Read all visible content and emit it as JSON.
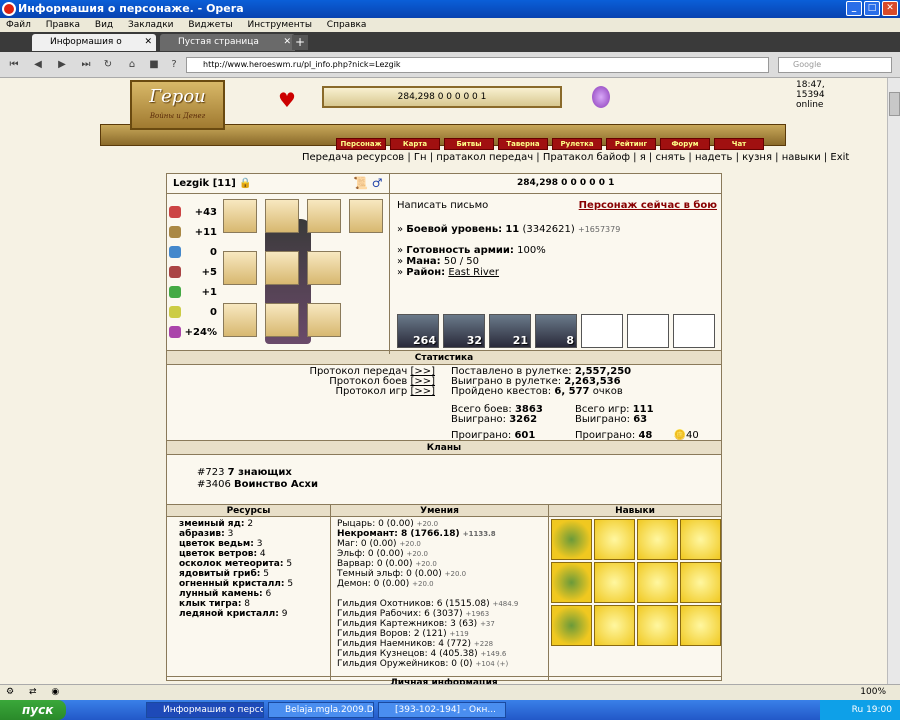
{
  "window": {
    "title": "Информашия о персонаже. - Opera"
  },
  "menu": [
    "Файл",
    "Правка",
    "Вид",
    "Закладки",
    "Виджеты",
    "Инструменты",
    "Справка"
  ],
  "tabs": [
    {
      "label": "Информашия о персона..."
    },
    {
      "label": "Пустая страница"
    }
  ],
  "address": {
    "url": "http://www.heroeswm.ru/pl_info.php?nick=Lezgik",
    "search_placeholder": "Google"
  },
  "header": {
    "online": "18:47, 15394 online",
    "logo": "Герои",
    "logo_sub": "Войны и Денег",
    "resources": "284,298 0 0 0 0 0 1",
    "nav": [
      "Персонаж",
      "Карта",
      "Битвы",
      "Таверна",
      "Рулетка",
      "Рейтинг",
      "Форум",
      "Чат"
    ],
    "sublinks": "Передача ресурсов | Гн | пратакол передач | Пратакол байоф | я | снять | надеть | кузня | навыки | Exit"
  },
  "character": {
    "name": "Lezgik",
    "level_tag": "[11]",
    "resources": "284,298 0 0 0 0 0 1",
    "stats": [
      {
        "icon": "attack-icon",
        "value": "+43",
        "color": "#c44"
      },
      {
        "icon": "defense-icon",
        "value": "+11",
        "color": "#a84"
      },
      {
        "icon": "spellpower-icon",
        "value": "0",
        "color": "#48c"
      },
      {
        "icon": "knowledge-icon",
        "value": "+5",
        "color": "#a44"
      },
      {
        "icon": "luck-icon",
        "value": "+1",
        "color": "#4a4"
      },
      {
        "icon": "morale-icon",
        "value": "0",
        "color": "#cc4"
      },
      {
        "icon": "initiative-icon",
        "value": "+24%",
        "color": "#a4a"
      }
    ],
    "write_letter": "Написать письмо",
    "in_battle": "Персонаж сейчас в бою",
    "combat_level_label": "Боевой уровень:",
    "combat_level": "11",
    "combat_exp": "(3342621)",
    "combat_gain": "+1657379",
    "army_ready_label": "Готовность армии:",
    "army_ready": "100%",
    "mana_label": "Мана:",
    "mana": "50 / 50",
    "district_label": "Район:",
    "district": "East River",
    "army": [
      "264",
      "32",
      "21",
      "8",
      "",
      "",
      ""
    ]
  },
  "statistics": {
    "title": "Статистика",
    "protocols": [
      "Протокол передач",
      "Протокол боев",
      "Протокол игр"
    ],
    "protocol_link": "[>>]",
    "roulette_bet_label": "Поставлено в рулетке:",
    "roulette_bet": "2,557,250",
    "roulette_won_label": "Выиграно в рулетке:",
    "roulette_won": "2,263,536",
    "quests_label": "Пройдено квестов:",
    "quests": "6, 577",
    "quests_unit": "очков",
    "battles_label": "Всего боев:",
    "battles": "3863",
    "battles_won_label": "Выиграно:",
    "battles_won": "3262",
    "battles_lost_label": "Проиграно:",
    "battles_lost": "601",
    "games_label": "Всего игр:",
    "games": "111",
    "games_won_label": "Выиграно:",
    "games_won": "63",
    "games_lost_label": "Проиграно:",
    "games_lost": "48",
    "gold": "40"
  },
  "clans": {
    "title": "Кланы",
    "items": [
      {
        "id": "#723",
        "name": "7 знающих"
      },
      {
        "id": "#3406",
        "name": "Воинство Асхи"
      }
    ]
  },
  "resources": {
    "title": "Ресурсы",
    "items": [
      [
        "змеиный яд:",
        "2"
      ],
      [
        "абразив:",
        "3"
      ],
      [
        "цветок ведьм:",
        "3"
      ],
      [
        "цветок ветров:",
        "4"
      ],
      [
        "осколок метеорита:",
        "5"
      ],
      [
        "ядовитый гриб:",
        "5"
      ],
      [
        "огненный кристалл:",
        "5"
      ],
      [
        "лунный камень:",
        "6"
      ],
      [
        "клык тигра:",
        "8"
      ],
      [
        "ледяной кристалл:",
        "9"
      ]
    ]
  },
  "skills": {
    "title": "Умения",
    "items": [
      [
        "Рыцарь: 0 (0.00)",
        "+20.0"
      ],
      [
        "Некромант: 8 (1766.18)",
        "+1133.8"
      ],
      [
        "Маг: 0 (0.00)",
        "+20.0"
      ],
      [
        "Эльф: 0 (0.00)",
        "+20.0"
      ],
      [
        "Варвар: 0 (0.00)",
        "+20.0"
      ],
      [
        "Темный эльф: 0 (0.00)",
        "+20.0"
      ],
      [
        "Демон: 0 (0.00)",
        "+20.0"
      ],
      [
        "",
        ""
      ],
      [
        "Гильдия Охотников: 6 (1515.08)",
        "+484.9"
      ],
      [
        "Гильдия Рабочих: 6 (3037)",
        "+1963"
      ],
      [
        "Гильдия Картежников: 3 (63)",
        "+37"
      ],
      [
        "Гильдия Воров: 2 (121)",
        "+119"
      ],
      [
        "Гильдия Наемников: 4 (772)",
        "+228"
      ],
      [
        "Гильдия Кузнецов: 4 (405.38)",
        "+149.6"
      ],
      [
        "Гильдия Оружейников: 0 (0)",
        "+104 (+)"
      ]
    ]
  },
  "talents": {
    "title": "Навыки"
  },
  "personal": {
    "title": "Личная информация"
  },
  "status": {
    "zoom": "100%"
  },
  "taskbar": {
    "start": "пуск",
    "tasks": [
      "Информашия о персо...",
      "Belaja.mgla.2009.D....",
      "[393-102-194] - Окн..."
    ],
    "clock": "19:00",
    "lang": "Ru"
  }
}
